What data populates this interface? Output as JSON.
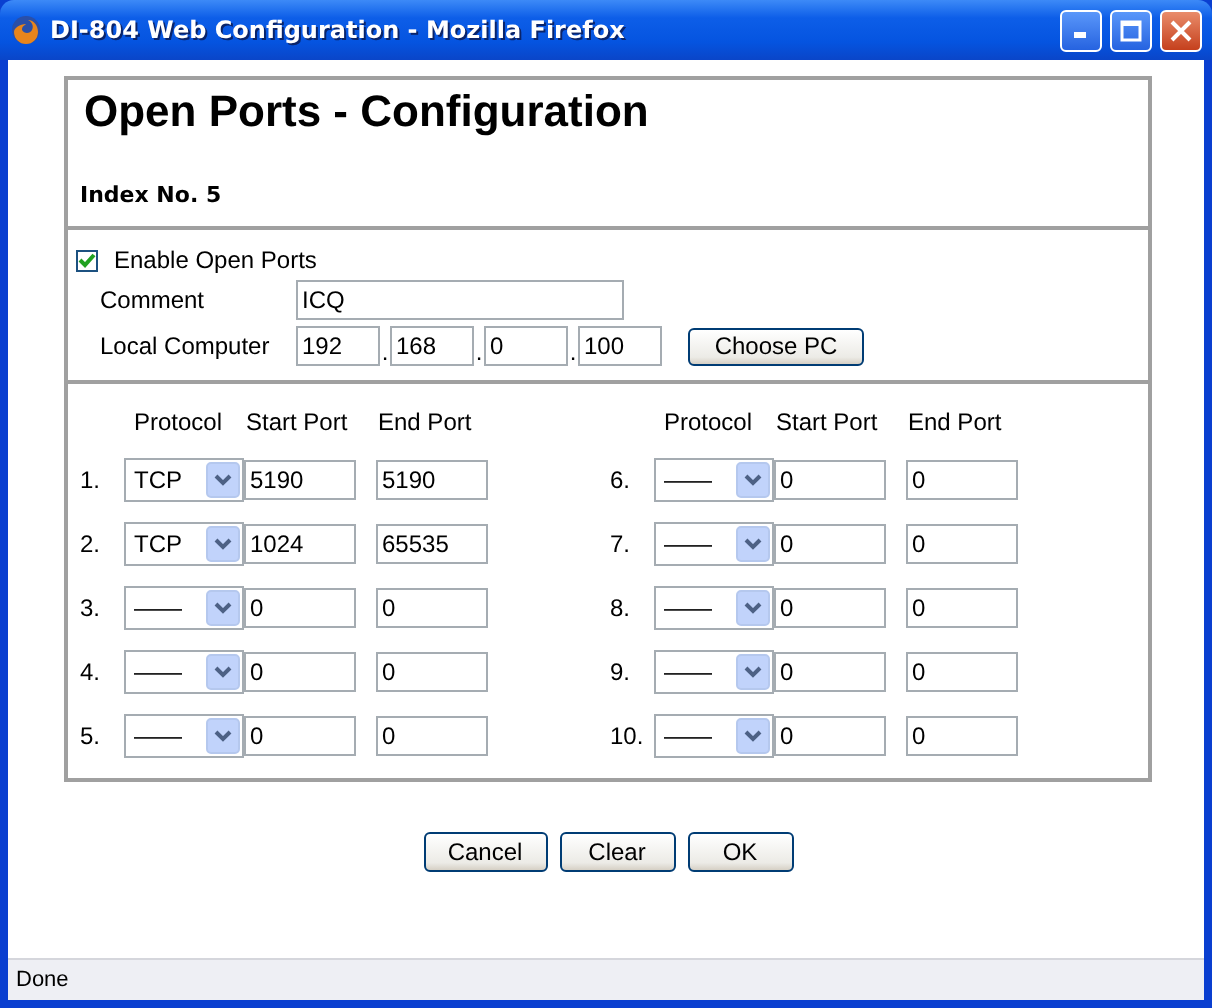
{
  "window": {
    "title": "DI-804 Web Configuration - Mozilla Firefox"
  },
  "page": {
    "heading": "Open Ports - Configuration",
    "index_label": "Index No. 5",
    "enable": {
      "label": "Enable Open Ports",
      "checked": true
    },
    "comment": {
      "label": "Comment",
      "value": "ICQ"
    },
    "local_computer": {
      "label": "Local Computer",
      "octets": [
        "192",
        "168",
        "0",
        "100"
      ],
      "separators": [
        ".",
        ".",
        "."
      ],
      "button": "Choose PC"
    },
    "port_groups": [
      {
        "headers": [
          "Protocol",
          "Start Port",
          "End Port"
        ],
        "rows": [
          {
            "number": "1.",
            "protocol": "TCP",
            "start": "5190",
            "end": "5190"
          },
          {
            "number": "2.",
            "protocol": "TCP",
            "start": "1024",
            "end": "65535"
          },
          {
            "number": "3.",
            "protocol": "——",
            "start": "0",
            "end": "0"
          },
          {
            "number": "4.",
            "protocol": "——",
            "start": "0",
            "end": "0"
          },
          {
            "number": "5.",
            "protocol": "——",
            "start": "0",
            "end": "0"
          }
        ]
      },
      {
        "headers": [
          "Protocol",
          "Start Port",
          "End Port"
        ],
        "rows": [
          {
            "number": "6.",
            "protocol": "——",
            "start": "0",
            "end": "0"
          },
          {
            "number": "7.",
            "protocol": "——",
            "start": "0",
            "end": "0"
          },
          {
            "number": "8.",
            "protocol": "——",
            "start": "0",
            "end": "0"
          },
          {
            "number": "9.",
            "protocol": "——",
            "start": "0",
            "end": "0"
          },
          {
            "number": "10.",
            "protocol": "——",
            "start": "0",
            "end": "0"
          }
        ]
      }
    ]
  },
  "buttons": [
    "Cancel",
    "Clear",
    "OK"
  ],
  "status_bar": "Done"
}
